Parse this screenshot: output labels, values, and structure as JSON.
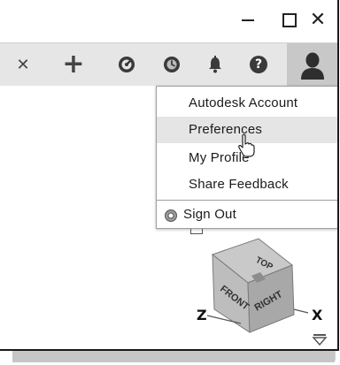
{
  "window": {
    "minimize_icon": "minimize-icon",
    "maximize_icon": "maximize-icon",
    "close_glyph": "✕"
  },
  "toolbar": {
    "tab_close_glyph": "✕",
    "new_tab_glyph": "+",
    "icons": [
      "learning-icon",
      "recent-icon",
      "notifications-icon",
      "help-icon",
      "account-avatar-icon"
    ],
    "help_glyph": "?"
  },
  "account_menu": {
    "items": [
      {
        "label": "Autodesk Account"
      },
      {
        "label": "Preferences"
      },
      {
        "label": "My Profile"
      },
      {
        "label": "Share Feedback"
      }
    ],
    "sign_out_label": "Sign Out",
    "highlighted_item": "Preferences"
  },
  "viewcube": {
    "top_label": "TOP",
    "front_label": "FRONT",
    "right_label": "RIGHT",
    "z_axis_label": "Z",
    "x_axis_label": "X"
  },
  "colors": {
    "toolbar_bg": "#e6e6e6",
    "account_button_bg": "#c8c8c8",
    "menu_highlight": "#e5e5e5",
    "icon_dark": "#3a3a3a"
  }
}
